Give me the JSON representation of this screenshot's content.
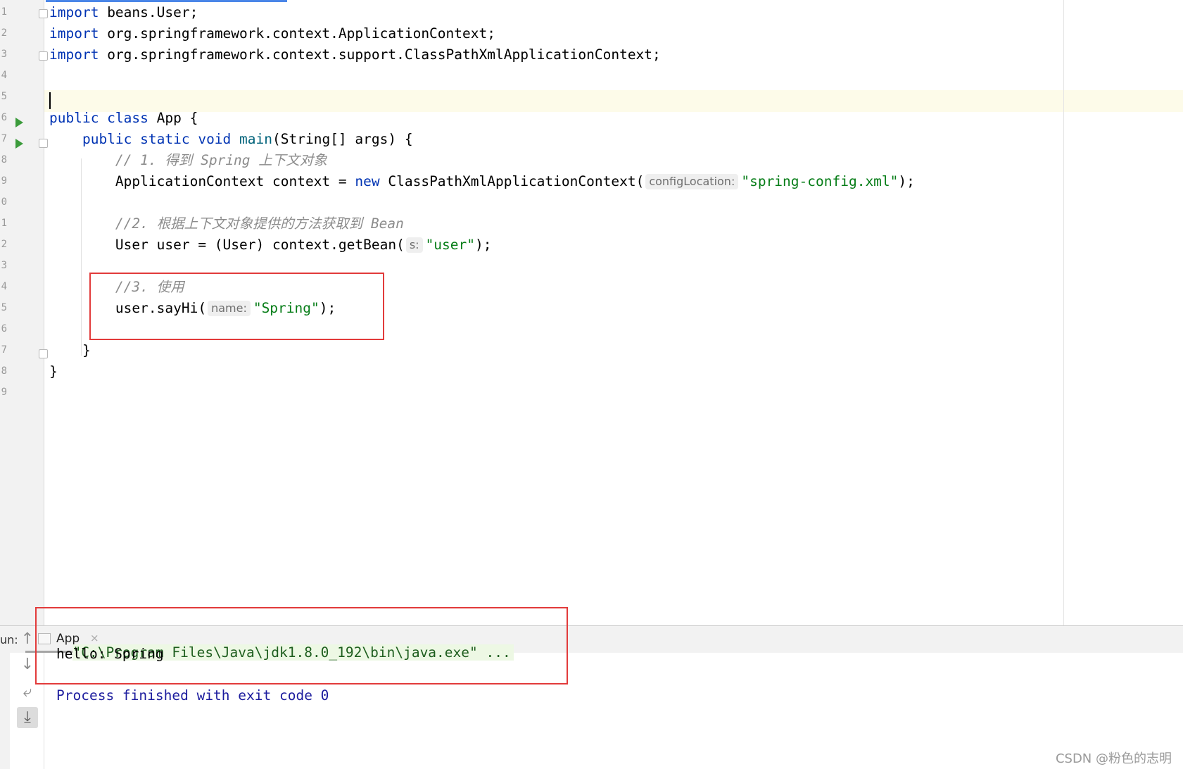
{
  "editor": {
    "line_numbers": [
      "1",
      "2",
      "3",
      "4",
      "5",
      "6",
      "7",
      "8",
      "9",
      "0",
      "1",
      "2",
      "3",
      "4",
      "5",
      "6",
      "7",
      "8",
      "9"
    ],
    "code": [
      {
        "parts": [
          {
            "t": "kw",
            "v": "import"
          },
          {
            "t": "plain",
            "v": " beans.User;"
          }
        ]
      },
      {
        "parts": [
          {
            "t": "kw",
            "v": "import"
          },
          {
            "t": "plain",
            "v": " org.springframework.context.ApplicationContext;"
          }
        ]
      },
      {
        "parts": [
          {
            "t": "kw",
            "v": "import"
          },
          {
            "t": "plain",
            "v": " org.springframework.context.support.ClassPathXmlApplicationContext;"
          }
        ]
      },
      {
        "parts": []
      },
      {
        "parts": []
      },
      {
        "parts": [
          {
            "t": "kw",
            "v": "public class"
          },
          {
            "t": "plain",
            "v": " App {"
          }
        ]
      },
      {
        "parts": [
          {
            "t": "plain",
            "v": "    "
          },
          {
            "t": "kw",
            "v": "public static void"
          },
          {
            "t": "plain",
            "v": " "
          },
          {
            "t": "mth",
            "v": "main"
          },
          {
            "t": "plain",
            "v": "(String[] args) {"
          }
        ]
      },
      {
        "parts": [
          {
            "t": "plain",
            "v": "        "
          },
          {
            "t": "cm",
            "v": "// 1. 得到 Spring 上下文对象"
          }
        ]
      },
      {
        "parts": [
          {
            "t": "plain",
            "v": "        ApplicationContext context = "
          },
          {
            "t": "kw",
            "v": "new"
          },
          {
            "t": "plain",
            "v": " ClassPathXmlApplicationContext("
          },
          {
            "t": "hint",
            "v": "configLocation:"
          },
          {
            "t": "str",
            "v": "\"spring-config.xml\""
          },
          {
            "t": "plain",
            "v": ");"
          }
        ]
      },
      {
        "parts": []
      },
      {
        "parts": [
          {
            "t": "plain",
            "v": "        "
          },
          {
            "t": "cm",
            "v": "//2. 根据上下文对象提供的方法获取到 Bean"
          }
        ]
      },
      {
        "parts": [
          {
            "t": "plain",
            "v": "        User user = (User) context.getBean("
          },
          {
            "t": "hint",
            "v": "s:"
          },
          {
            "t": "str",
            "v": "\"user\""
          },
          {
            "t": "plain",
            "v": ");"
          }
        ]
      },
      {
        "parts": []
      },
      {
        "parts": [
          {
            "t": "plain",
            "v": "        "
          },
          {
            "t": "cm",
            "v": "//3. 使用"
          }
        ]
      },
      {
        "parts": [
          {
            "t": "plain",
            "v": "        user.sayHi("
          },
          {
            "t": "hint",
            "v": "name:"
          },
          {
            "t": "str",
            "v": "\"Spring\""
          },
          {
            "t": "plain",
            "v": ");"
          }
        ]
      },
      {
        "parts": []
      },
      {
        "parts": [
          {
            "t": "plain",
            "v": "    }"
          }
        ]
      },
      {
        "parts": [
          {
            "t": "plain",
            "v": "}"
          }
        ]
      },
      {
        "parts": []
      }
    ]
  },
  "run_panel": {
    "label": "un:",
    "tab_label": "App",
    "tab_close": "×"
  },
  "console": {
    "command": "\"C:\\Program Files\\Java\\jdk1.8.0_192\\bin\\java.exe\" ...",
    "output": "hello: Spring",
    "exit_message": "Process finished with exit code 0"
  },
  "watermark": "CSDN @粉色的志明",
  "colors": {
    "keyword": "#0033b3",
    "string": "#067d17",
    "comment": "#8c8c8c",
    "highlight_box": "#e23b3b",
    "run_icon": "#3b9b3b"
  }
}
